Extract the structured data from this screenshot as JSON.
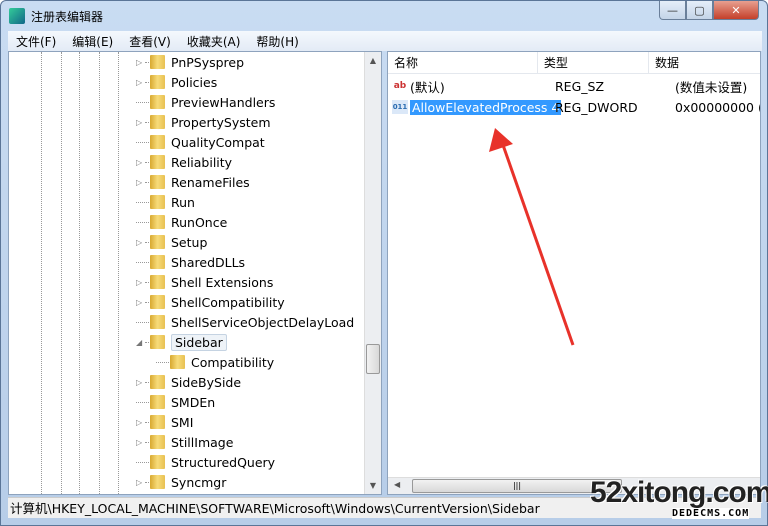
{
  "window": {
    "title": "注册表编辑器",
    "min": "—",
    "max": "▢",
    "close": "✕"
  },
  "menu": [
    "文件(F)",
    "编辑(E)",
    "查看(V)",
    "收藏夹(A)",
    "帮助(H)"
  ],
  "tree": [
    {
      "label": "PnPSysprep",
      "expander": "collapsed"
    },
    {
      "label": "Policies",
      "expander": "collapsed"
    },
    {
      "label": "PreviewHandlers",
      "expander": "none"
    },
    {
      "label": "PropertySystem",
      "expander": "collapsed"
    },
    {
      "label": "QualityCompat",
      "expander": "none"
    },
    {
      "label": "Reliability",
      "expander": "collapsed"
    },
    {
      "label": "RenameFiles",
      "expander": "collapsed"
    },
    {
      "label": "Run",
      "expander": "none"
    },
    {
      "label": "RunOnce",
      "expander": "none"
    },
    {
      "label": "Setup",
      "expander": "collapsed"
    },
    {
      "label": "SharedDLLs",
      "expander": "none"
    },
    {
      "label": "Shell Extensions",
      "expander": "collapsed"
    },
    {
      "label": "ShellCompatibility",
      "expander": "collapsed"
    },
    {
      "label": "ShellServiceObjectDelayLoad",
      "expander": "none"
    },
    {
      "label": "Sidebar",
      "expander": "expanded",
      "selected": true
    },
    {
      "label": "Compatibility",
      "expander": "none",
      "child": true
    },
    {
      "label": "SideBySide",
      "expander": "collapsed"
    },
    {
      "label": "SMDEn",
      "expander": "none"
    },
    {
      "label": "SMI",
      "expander": "collapsed"
    },
    {
      "label": "StillImage",
      "expander": "collapsed"
    },
    {
      "label": "StructuredQuery",
      "expander": "none"
    },
    {
      "label": "Syncmgr",
      "expander": "collapsed"
    }
  ],
  "columns": [
    "名称",
    "类型",
    "数据"
  ],
  "values": [
    {
      "icon": "string-value-icon",
      "glyph": "ab",
      "name": "(默认)",
      "type": "REG_SZ",
      "data": "(数值未设置)"
    },
    {
      "icon": "dword-value-icon",
      "glyph": "011",
      "name": "AllowElevatedProcess 4",
      "type": "REG_DWORD",
      "data": "0x00000000 (0",
      "selected": true
    }
  ],
  "status": "计算机\\HKEY_LOCAL_MACHINE\\SOFTWARE\\Microsoft\\Windows\\CurrentVersion\\Sidebar",
  "watermark": {
    "main": "52xitong.com",
    "sub": "DEDECMS.COM"
  },
  "colors": {
    "selection": "#3399ff",
    "arrow": "#e8322a",
    "close": "#c4402a"
  }
}
